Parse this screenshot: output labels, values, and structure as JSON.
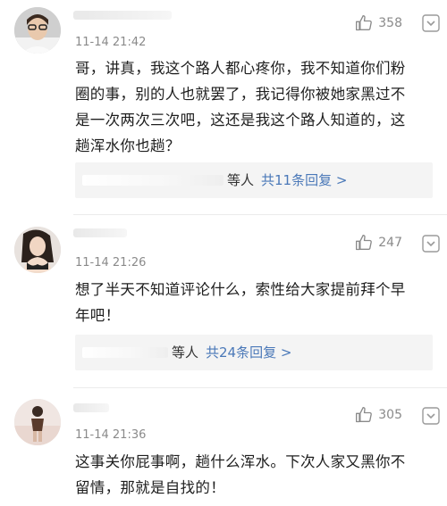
{
  "comments": [
    {
      "time": "11-14 21:42",
      "likes": "358",
      "text_lines": [
        "哥，讲真，我这个路人都心疼你，我不知道你们粉",
        "圈的事，别的人也就罢了，我记得你被她家黑过不",
        "是一次两次三次吧，这还是我这个路人知道的，这",
        "趟浑水你也趟？"
      ],
      "replies_suffix": "等人",
      "replies_count": "共11条回复 >"
    },
    {
      "time": "11-14 21:26",
      "likes": "247",
      "text_lines": [
        "想了半天不知道评论什么，索性给大家提前拜个早",
        "年吧！"
      ],
      "replies_suffix": "等人",
      "replies_count": "共24条回复 >"
    },
    {
      "time": "11-14 21:36",
      "likes": "305",
      "text_lines": [
        "这事关你屁事啊，趟什么浑水。下次人家又黑你不",
        "留情，那就是自找的！"
      ]
    }
  ],
  "icons": {
    "like": "thumbs-up-icon",
    "more": "chevron-down-icon"
  },
  "colors": {
    "accent_link": "#4a78b8",
    "meta_gray": "#8a8a8a",
    "reply_bg": "#f4f4f4"
  }
}
